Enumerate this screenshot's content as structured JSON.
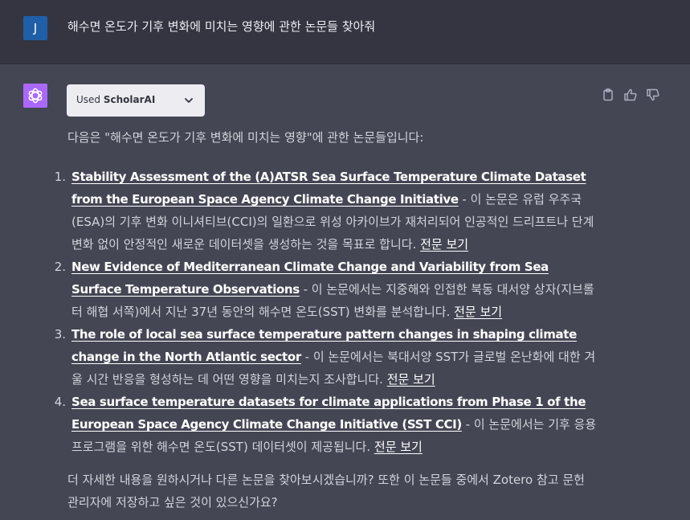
{
  "user": {
    "avatar_initial": "J",
    "message": "해수면 온도가 기후 변화에 미치는 영향에 관한 논문들 찾아줘"
  },
  "plugin": {
    "prefix": "Used",
    "name": "ScholarAI"
  },
  "assistant": {
    "intro": "다음은 \"해수면 온도가 기후 변화에 미치는 영향\"에 관한 논문들입니다:",
    "papers": [
      {
        "number": "1.",
        "title": "Stability Assessment of the (A)ATSR Sea Surface Temperature Climate Dataset from the European Space Agency Climate Change Initiative",
        "summary": " - 이 논문은 유럽 우주국(ESA)의 기후 변화 이니셔티브(CCI)의 일환으로 위성 아카이브가 재처리되어 인공적인 드리프트나 단계 변화 없이 안정적인 새로운 데이터셋을 생성하는 것을 목표로 합니다. ",
        "link_label": "전문 보기"
      },
      {
        "number": "2.",
        "title": "New Evidence of Mediterranean Climate Change and Variability from Sea Surface Temperature Observations",
        "summary": " - 이 논문에서는 지중해와 인접한 북동 대서양 상자(지브롤터 해협 서쪽)에서 지난 37년 동안의 해수면 온도(SST) 변화를 분석합니다. ",
        "link_label": "전문 보기"
      },
      {
        "number": "3.",
        "title": "The role of local sea surface temperature pattern changes in shaping climate change in the North Atlantic sector",
        "summary": " - 이 논문에서는 북대서양 SST가 글로벌 온난화에 대한 겨울 시간 반응을 형성하는 데 어떤 영향을 미치는지 조사합니다. ",
        "link_label": "전문 보기"
      },
      {
        "number": "4.",
        "title": "Sea surface temperature datasets for climate applications from Phase 1 of the European Space Agency Climate Change Initiative (SST CCI)",
        "summary": " - 이 논문에서는 기후 응용 프로그램을 위한 해수면 온도(SST) 데이터셋이 제공됩니다. ",
        "link_label": "전문 보기"
      }
    ],
    "outro": "더 자세한 내용을 원하시거나 다른 논문을 찾아보시겠습니까? 또한 이 논문들 중에서 Zotero 참고 문헌 관리자에 저장하고 싶은 것이 있으신가요?"
  },
  "icons": {
    "chip_toggle": "chevron-down-icon",
    "copy": "clipboard-icon",
    "like": "thumbs-up-icon",
    "dislike": "thumbs-down-icon",
    "assistant_avatar": "openai-logo-icon"
  },
  "colors": {
    "user_row_bg": "#343541",
    "assistant_row_bg": "#444654",
    "user_avatar_bg": "#1f5fa8",
    "assistant_avatar_bg": "#ab68ff",
    "chip_bg": "#ececf1"
  }
}
